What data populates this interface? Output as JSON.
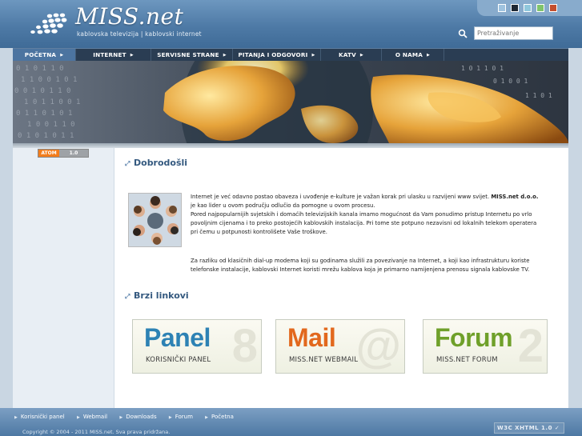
{
  "header": {
    "logo_title": "MISS.net",
    "logo_tagline": "kablovska televizija | kablovski internet",
    "theme_swatches": [
      "#9fc3df",
      "#1e2733",
      "#8fc7dc",
      "#7fc46c",
      "#c44e2d"
    ],
    "search_placeholder": "Pretraživanje",
    "search_icon": "magnifier-icon"
  },
  "nav": {
    "items": [
      {
        "label": "POČETNA",
        "active": true
      },
      {
        "label": "INTERNET"
      },
      {
        "label": "SERVISNE STRANE"
      },
      {
        "label": "PITANJA I ODGOVORI"
      },
      {
        "label": "KATV"
      },
      {
        "label": "O NAMA"
      }
    ]
  },
  "sidebar": {
    "atom_left": "ATOM",
    "atom_right": "1.0"
  },
  "main": {
    "welcome_title": "Dobrodošli",
    "para1_a": "Internet je već odavno postao obaveza i uvođenje e-kulture je važan korak pri ulasku u razvijeni www svijet. ",
    "para1_bold": "MISS.net d.o.o.",
    "para1_line2": "je kao lider u ovom području odlučio da pomogne u ovom procesu.",
    "para2_line1": "Pored najpopularnijih svjetskih i domaćih televizijskih kanala imamo mogućnost da Vam ponudimo pristup Internetu po vrlo",
    "para2_line2": "povoljnim cijenama i to preko postojećih kablovskih instalacija. Pri tome ste potpuno nezavisni od lokalnih telekom operatera",
    "para2_line3": "pri čemu u potpunosti kontrolišete Vaše troškove.",
    "para3_line1": "Za razliku od klasičnih dial-up modema koji su godinama služili za povezivanje na Internet, a koji kao infrastrukturu koriste",
    "para3_line2": "telefonske instalacije, kablovski Internet koristi mrežu kablova koja je primarno namijenjena prenosu signala kablovske TV.",
    "quick_title": "Brzi linkovi",
    "cards": [
      {
        "word": "Panel",
        "sub": "KORISNIČKI PANEL",
        "color": "#2d82b4",
        "deco": "8"
      },
      {
        "word": "Mail",
        "sub": "MISS.NET WEBMAIL",
        "color": "#e2681d",
        "deco": "@"
      },
      {
        "word": "Forum",
        "sub": "MISS.NET FORUM",
        "color": "#6fa02a",
        "deco": "2"
      }
    ]
  },
  "footer": {
    "links": [
      "Korisnički panel",
      "Webmail",
      "Downloads",
      "Forum",
      "Početna"
    ],
    "copyright": "Copyright © 2004 - 2011 MISS.net. Sva prava pridržana.",
    "badge": "W3C  XHTML 1.0 ✓"
  }
}
